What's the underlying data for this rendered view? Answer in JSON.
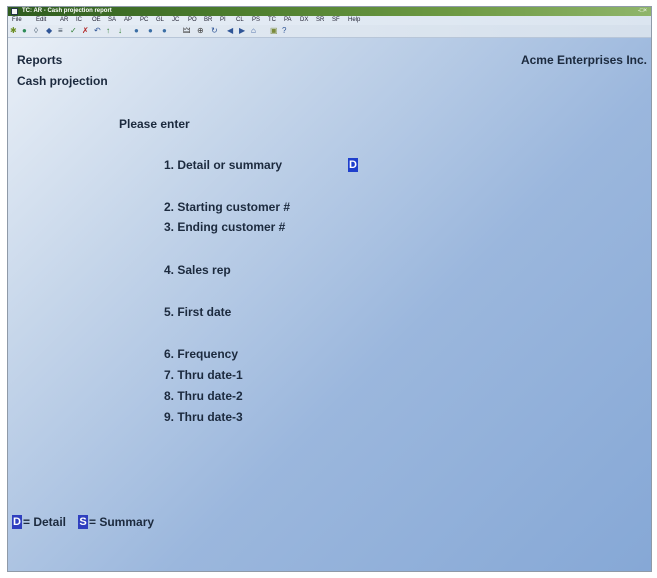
{
  "window": {
    "title": "TC: AR - Cash projection report",
    "controls": "-□×"
  },
  "menu": [
    "File",
    "Edit",
    "AR",
    "IC",
    "OE",
    "SA",
    "AP",
    "PC",
    "GL",
    "JC",
    "PO",
    "BR",
    "PI",
    "CL",
    "PS",
    "TC",
    "PA",
    "DX",
    "SR",
    "SF",
    "Help"
  ],
  "toolbar_icons": [
    {
      "name": "app-icon",
      "glyph": "✱",
      "color": "#6b8e23"
    },
    {
      "name": "save-icon",
      "glyph": "●",
      "color": "#2e8b57"
    },
    {
      "name": "find-icon",
      "glyph": "◊",
      "color": "#5a6b7d"
    },
    {
      "name": "clear-icon",
      "glyph": "◆",
      "color": "#2f5597"
    },
    {
      "name": "list-icon",
      "glyph": "≡",
      "color": "#3b4a5a"
    },
    {
      "name": "check-icon",
      "glyph": "✓",
      "color": "#2e7d32"
    },
    {
      "name": "x-icon",
      "glyph": "✗",
      "color": "#b22222"
    },
    {
      "name": "undo-icon",
      "glyph": "↶",
      "color": "#2f5597"
    },
    {
      "name": "up-icon",
      "glyph": "↑",
      "color": "#2e7d32"
    },
    {
      "name": "down-icon",
      "glyph": "↓",
      "color": "#2e7d32"
    },
    {
      "name": "circle1-icon",
      "glyph": "●",
      "color": "#3a6ea5"
    },
    {
      "name": "circle2-icon",
      "glyph": "●",
      "color": "#3a6ea5"
    },
    {
      "name": "circle3-icon",
      "glyph": "●",
      "color": "#3a6ea5"
    },
    {
      "name": "binoculars-icon",
      "glyph": "🜲",
      "color": "#444"
    },
    {
      "name": "zoom-icon",
      "glyph": "⊕",
      "color": "#444"
    },
    {
      "name": "refresh-icon",
      "glyph": "↻",
      "color": "#2f5597"
    },
    {
      "name": "prev-icon",
      "glyph": "◀",
      "color": "#2f5597"
    },
    {
      "name": "next-icon",
      "glyph": "▶",
      "color": "#2f5597"
    },
    {
      "name": "home-icon",
      "glyph": "⌂",
      "color": "#2f5597"
    },
    {
      "name": "lock-icon",
      "glyph": "▣",
      "color": "#7a8a3a"
    },
    {
      "name": "help-icon",
      "glyph": "?",
      "color": "#2f5597"
    }
  ],
  "header": {
    "left": "Reports",
    "right": "Acme Enterprises Inc.",
    "subtitle": "Cash projection"
  },
  "prompt": "Please enter",
  "fields": [
    {
      "label": "1. Detail or summary",
      "value": "D"
    },
    {
      "label": "2. Starting customer #"
    },
    {
      "label": "3. Ending customer #"
    },
    {
      "label": "4. Sales rep"
    },
    {
      "label": "5. First date"
    },
    {
      "label": "6. Frequency"
    },
    {
      "label": "7. Thru date-1"
    },
    {
      "label": "8. Thru date-2"
    },
    {
      "label": "9. Thru date-3"
    }
  ],
  "legend": [
    {
      "key": "D",
      "text": "= Detail"
    },
    {
      "key": "S",
      "text": "= Summary"
    }
  ]
}
